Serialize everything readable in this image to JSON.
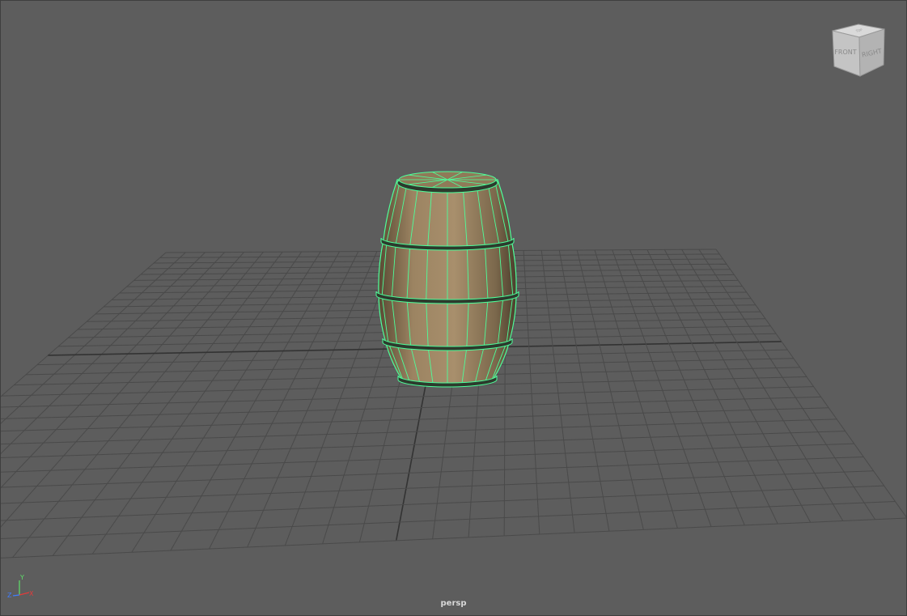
{
  "viewport": {
    "camera_label": "persp",
    "background_color": "#5d5d5d",
    "grid_color": "#4a4a4a",
    "grid_axis_color": "#333333",
    "selection_wire_color": "#4dff9a"
  },
  "view_cube": {
    "front_label": "FRONT",
    "right_label": "RIGHT",
    "top_label": "TOP"
  },
  "axis_gizmo": {
    "x_label": "X",
    "y_label": "Y",
    "z_label": "Z",
    "x_color": "#e23b3b",
    "y_color": "#5ee06a",
    "z_color": "#3f7dff"
  },
  "scene_object": {
    "icon": "barrel-mesh-icon",
    "wood_color": "#9c8462",
    "hoop_color": "#2d3a2d"
  }
}
